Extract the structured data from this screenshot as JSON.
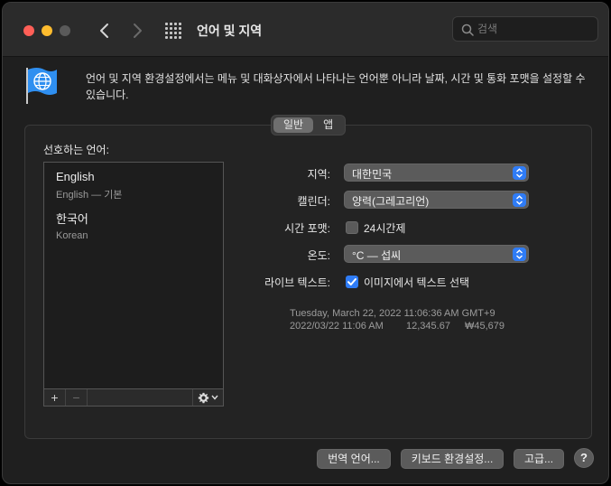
{
  "window": {
    "title": "언어 및 지역"
  },
  "search": {
    "placeholder": "검색"
  },
  "description": "언어 및 지역 환경설정에서는 메뉴 및 대화상자에서 나타나는 언어뿐 아니라 날짜, 시간 및 통화 포맷을 설정할 수 있습니다.",
  "tabs": [
    {
      "label": "일반",
      "active": true
    },
    {
      "label": "앱",
      "active": false
    }
  ],
  "preferred_languages": {
    "label": "선호하는 언어:",
    "items": [
      {
        "name": "English",
        "sub": "English — 기본"
      },
      {
        "name": "한국어",
        "sub": "Korean"
      }
    ],
    "add_label": "+",
    "remove_label": "−"
  },
  "settings": {
    "region": {
      "label": "지역:",
      "value": "대한민국"
    },
    "calendar": {
      "label": "캘린더:",
      "value": "양력(그레고리언)"
    },
    "time_format": {
      "label": "시간 포맷:",
      "checkbox_label": "24시간제",
      "checked": false
    },
    "temperature": {
      "label": "온도:",
      "value": "°C — 섭씨"
    },
    "live_text": {
      "label": "라이브 텍스트:",
      "checkbox_label": "이미지에서 텍스트 선택",
      "checked": true
    }
  },
  "sample": {
    "line1": "Tuesday, March 22, 2022 11:06:36 AM GMT+9",
    "date_time": "2022/03/22 11:06 AM",
    "number": "12,345.67",
    "currency": "₩45,679"
  },
  "buttons": {
    "translation": "번역 언어...",
    "keyboard": "키보드 환경설정...",
    "advanced": "고급...",
    "help": "?"
  },
  "colors": {
    "accent": "#2f7cf6",
    "window_bg": "#1f1f1f",
    "titlebar_bg": "#2b2b2b"
  }
}
